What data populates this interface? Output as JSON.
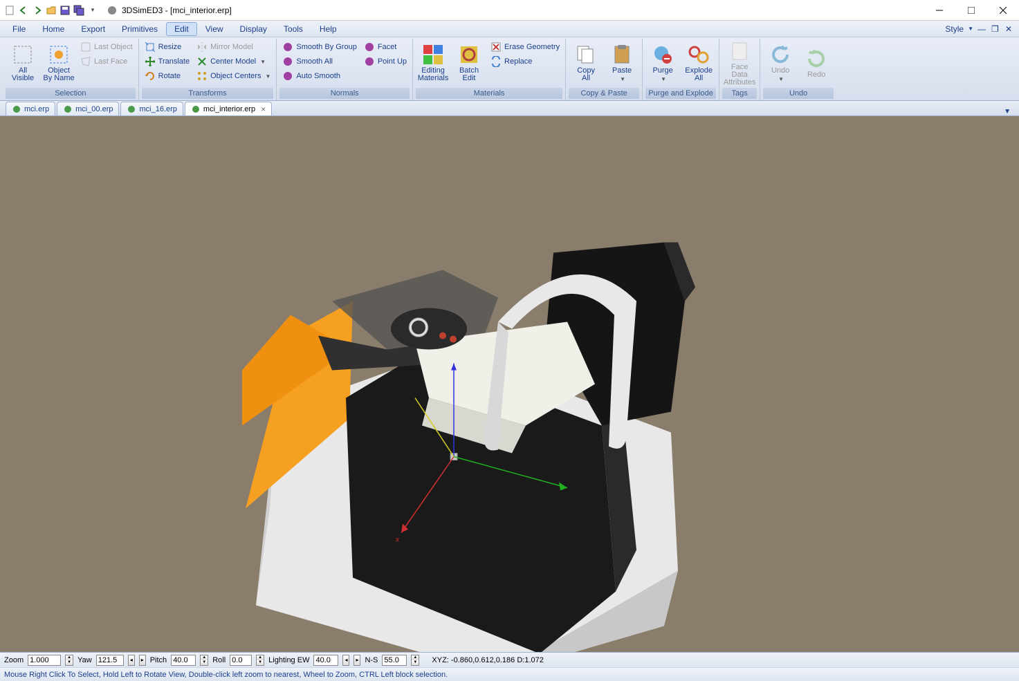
{
  "title": "3DSimED3 - [mci_interior.erp]",
  "menu": {
    "file": "File",
    "home": "Home",
    "export": "Export",
    "primitives": "Primitives",
    "edit": "Edit",
    "view": "View",
    "display": "Display",
    "tools": "Tools",
    "help": "Help",
    "style": "Style"
  },
  "ribbon": {
    "selection": {
      "label": "Selection",
      "all_visible": "All\nVisible",
      "object_by_name": "Object\nBy Name",
      "last_object": "Last Object",
      "last_face": "Last Face"
    },
    "transforms": {
      "label": "Transforms",
      "resize": "Resize",
      "translate": "Translate",
      "rotate": "Rotate",
      "mirror_model": "Mirror Model",
      "center_model": "Center Model",
      "object_centers": "Object Centers"
    },
    "normals": {
      "label": "Normals",
      "smooth_by_group": "Smooth By Group",
      "smooth_all": "Smooth All",
      "auto_smooth": "Auto Smooth",
      "facet": "Facet",
      "point_up": "Point Up"
    },
    "materials": {
      "label": "Materials",
      "editing_materials": "Editing\nMaterials",
      "batch_edit": "Batch\nEdit",
      "erase_geometry": "Erase Geometry",
      "replace": "Replace"
    },
    "copy_paste": {
      "label": "Copy & Paste",
      "copy_all": "Copy\nAll",
      "paste": "Paste"
    },
    "purge_explode": {
      "label": "Purge and Explode",
      "purge": "Purge",
      "explode_all": "Explode\nAll"
    },
    "tags": {
      "label": "Tags",
      "face_data": "Face Data\nAttributes"
    },
    "undo": {
      "label": "Undo",
      "undo": "Undo",
      "redo": "Redo"
    }
  },
  "tabs": {
    "t1": "mci.erp",
    "t2": "mci_00.erp",
    "t3": "mci_16.erp",
    "t4": "mci_interior.erp"
  },
  "status": {
    "zoom_lbl": "Zoom",
    "zoom": "1.000",
    "yaw_lbl": "Yaw",
    "yaw": "121.5",
    "pitch_lbl": "Pitch",
    "pitch": "40.0",
    "roll_lbl": "Roll",
    "roll": "0.0",
    "light_lbl": "Lighting EW",
    "light": "40.0",
    "ns_lbl": "N-S",
    "ns": "55.0",
    "xyz": "XYZ: -0.860,0.612,0.186 D:1.072",
    "hint": "Mouse Right Click To Select, Hold Left to Rotate View, Double-click left  zoom to nearest, Wheel to Zoom, CTRL Left block selection."
  }
}
